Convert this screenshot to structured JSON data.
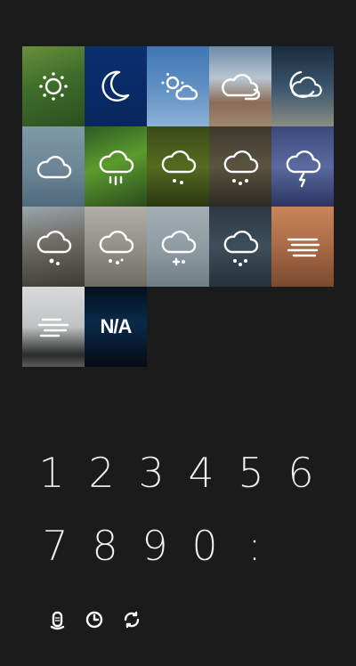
{
  "tiles": [
    {
      "icon": "sun-icon",
      "bg": "linear-gradient(160deg,#6a8f3a 0%,#3f6d2a 45%,#2c4f1f 100%)"
    },
    {
      "icon": "moon-icon",
      "bg": "linear-gradient(180deg,#0c2f6e 0%,#082a66 60%,#0a275b 100%)"
    },
    {
      "icon": "sun-cloud-icon",
      "bg": "linear-gradient(180deg,#3f76b3 0%,#6695c6 60%,#8db0d6 100%)"
    },
    {
      "icon": "cloud-sun-icon",
      "bg": "linear-gradient(180deg,#6d8ca6 0%,#b9c6d1 40%,#8b6b57 70%,#a08772 100%)"
    },
    {
      "icon": "moon-cloud-icon",
      "bg": "linear-gradient(180deg,#1a2c3d 0%,#3e5870 55%,#8b8f82 100%)"
    },
    {
      "icon": "cloud-icon",
      "bg": "linear-gradient(180deg,#7e99a8 0%,#6c8595 55%,#4f6a7c 100%)"
    },
    {
      "icon": "cloud-rain-icon",
      "bg": "linear-gradient(160deg,#2e5a24 0%,#5c9b2e 45%,#2a4a1e 100%)"
    },
    {
      "icon": "cloud-drizzle-icon",
      "bg": "linear-gradient(180deg,#3a4a18 0%,#556b20 50%,#2a3612 100%)"
    },
    {
      "icon": "cloud-showers-icon",
      "bg": "linear-gradient(180deg,#3e3a2c 0%,#5a5440 50%,#2c2a22 100%)"
    },
    {
      "icon": "cloud-lightning-icon",
      "bg": "linear-gradient(180deg,#3a4a7a 0%,#5a6aa0 50%,#2a3560 100%)"
    },
    {
      "icon": "cloud-hail-icon",
      "bg": "linear-gradient(170deg,#9aa6ad 0%,#6e6c64 45%,#3c3a36 100%)"
    },
    {
      "icon": "cloud-sleet-icon",
      "bg": "linear-gradient(180deg,#b0afa8 0%,#8f8d84 55%,#6e6b62 100%)"
    },
    {
      "icon": "cloud-snow-icon",
      "bg": "linear-gradient(180deg,#a3aeb4 0%,#8d9aa1 55%,#6f7d85 100%)"
    },
    {
      "icon": "cloud-snow-heavy-icon",
      "bg": "linear-gradient(180deg,#2c3a44 0%,#3d4e5a 50%,#26323a 100%)"
    },
    {
      "icon": "wind-icon",
      "bg": "linear-gradient(180deg,#c9855a 0%,#a96a45 50%,#7a4a2e 100%)"
    },
    {
      "icon": "fog-icon",
      "bg": "linear-gradient(180deg,#d9dadb 0%,#bfc1c2 50%,#2a2c2c 85%,#5a5c5c 100%)"
    },
    {
      "icon": "na-icon",
      "label": "N/A",
      "bg": "linear-gradient(180deg,#04101e 0%,#0a2a4a 45%,#050b14 100%)"
    }
  ],
  "digits_row1": [
    "1",
    "2",
    "3",
    "4",
    "5",
    "6"
  ],
  "digits_row2": [
    "7",
    "8",
    "9",
    "0",
    ":"
  ],
  "bottom_icons": [
    "battery-icon",
    "clock-icon",
    "refresh-icon"
  ]
}
